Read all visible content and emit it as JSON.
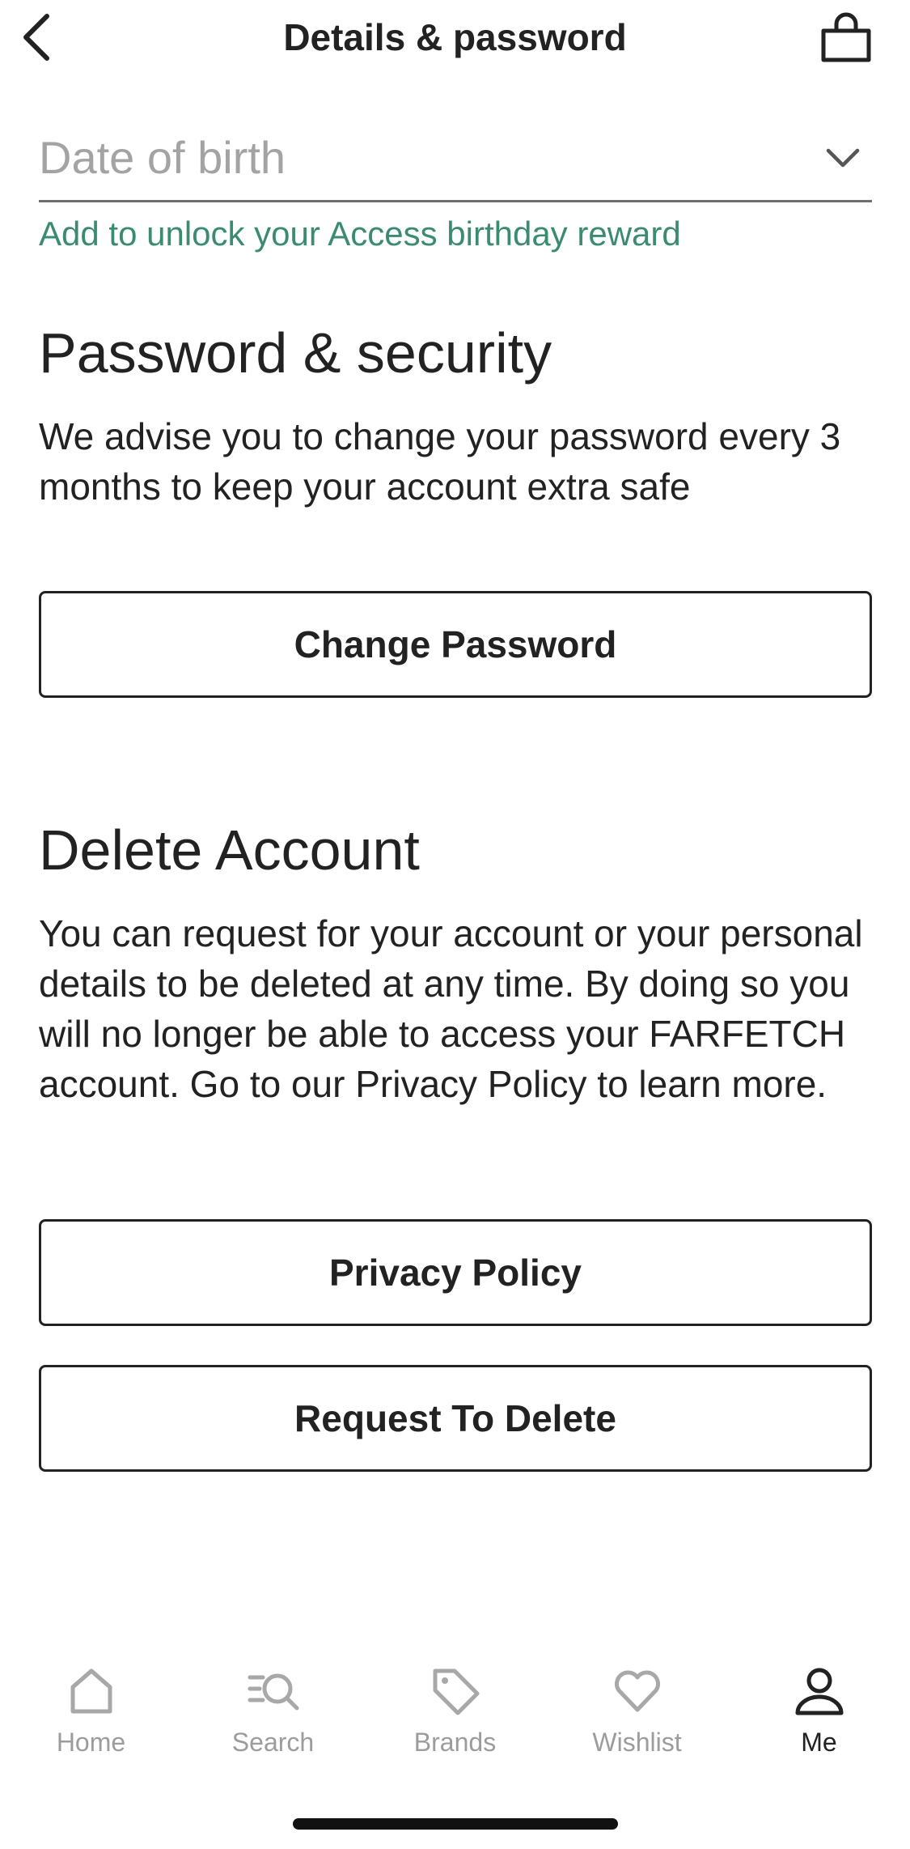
{
  "header": {
    "title": "Details & password",
    "back_icon": "chevron-left-icon",
    "bag_icon": "shopping-bag-icon"
  },
  "dob": {
    "placeholder": "Date of birth",
    "hint": "Add to unlock your Access birthday reward",
    "chevron_icon": "chevron-down-icon"
  },
  "password_section": {
    "title": "Password & security",
    "description": "We advise you to change your password every 3 months to keep your account extra safe",
    "button_label": "Change Password"
  },
  "delete_section": {
    "title": "Delete Account",
    "description": "You can request for your account or your personal details to be deleted at any time. By doing so you will no longer be able to access your FARFETCH account. Go to our Privacy Policy to learn more.",
    "privacy_button_label": "Privacy Policy",
    "delete_button_label": "Request To Delete"
  },
  "tabbar": {
    "items": [
      {
        "label": "Home",
        "icon": "home-icon",
        "active": false
      },
      {
        "label": "Search",
        "icon": "search-icon",
        "active": false
      },
      {
        "label": "Brands",
        "icon": "tag-icon",
        "active": false
      },
      {
        "label": "Wishlist",
        "icon": "heart-icon",
        "active": false
      },
      {
        "label": "Me",
        "icon": "user-icon",
        "active": true
      }
    ]
  },
  "colors": {
    "accent_green": "#3b8a72",
    "text": "#222222",
    "inactive": "#9c9c9c"
  }
}
